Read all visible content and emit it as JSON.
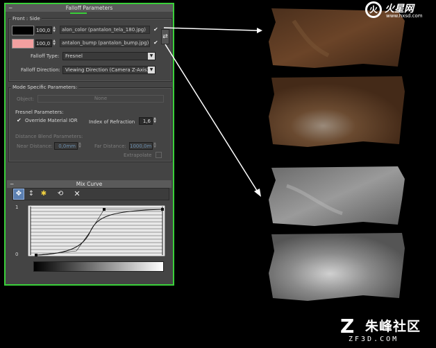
{
  "falloff": {
    "title": "Falloff Parameters",
    "front_side_label": "Front : Side",
    "rows": [
      {
        "value": "100,0",
        "map": "alon_color (pantalon_tela_180.jpg)",
        "swatch": "#000000"
      },
      {
        "value": "100,0",
        "map": "antalon_bump (pantalon_bump.jpg)",
        "swatch": "#f2a0a0"
      }
    ],
    "falloff_type_label": "Falloff Type:",
    "falloff_type_value": "Fresnel",
    "falloff_direction_label": "Falloff Direction:",
    "falloff_direction_value": "Viewing Direction (Camera Z-Axis)"
  },
  "mode": {
    "group_label": "Mode Specific Parameters:",
    "object_label": "Object:",
    "object_value": "None",
    "fresnel_label": "Fresnel Parameters:",
    "override_label": "Override Material IOR",
    "ior_label": "Index of Refraction",
    "ior_value": "1,6",
    "distance_label": "Distance Blend Parameters:",
    "near_label": "Near Distance:",
    "near_value": "0,0mm",
    "far_label": "Far Distance:",
    "far_value": "1000,0m",
    "extrapolate_label": "Extrapolate"
  },
  "mix_curve": {
    "title": "Mix Curve",
    "y_top": "1",
    "y_bottom": "0"
  },
  "watermark": {
    "top_text": "火星网",
    "top_url": "www.hxsd.com",
    "bottom_text": "朱峰社区",
    "bottom_url": "ZF3D.COM"
  },
  "colors": {
    "panel_border": "#3ad13a",
    "brown_texture": "#5a3a22",
    "grey_texture": "#8a8a8a"
  }
}
